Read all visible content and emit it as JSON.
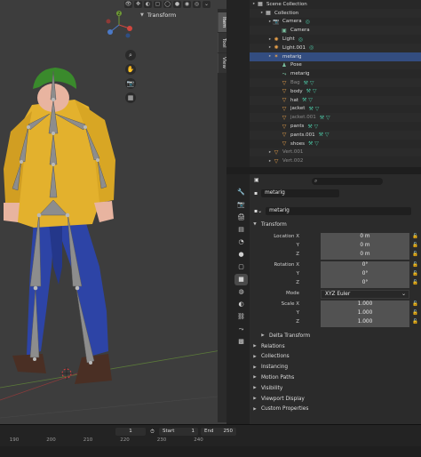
{
  "viewport": {
    "panel_title": "Transform",
    "side_tabs": [
      "Item",
      "Tool",
      "View"
    ],
    "nav_buttons": [
      "zoom-icon",
      "hand-icon",
      "camera-icon",
      "grid-icon"
    ],
    "gizmo_label": "Z"
  },
  "timeline": {
    "current_frame": "1",
    "start_label": "Start",
    "start_value": "1",
    "end_label": "End",
    "end_value": "250",
    "ticks": [
      "190",
      "200",
      "210",
      "220",
      "230",
      "240"
    ]
  },
  "outliner": {
    "rows": [
      {
        "label": "Scene Collection",
        "depth": 0,
        "icon": "collection-icon",
        "dim": false,
        "sel": false
      },
      {
        "label": "Collection",
        "depth": 1,
        "icon": "collection-icon",
        "dim": false,
        "sel": false
      },
      {
        "label": "Camera",
        "depth": 2,
        "icon": "camera-object-icon",
        "dim": false,
        "sel": false
      },
      {
        "label": "Camera",
        "depth": 3,
        "icon": "camera-data-icon",
        "dim": false,
        "sel": false
      },
      {
        "label": "Light",
        "depth": 2,
        "icon": "light-icon",
        "dim": false,
        "sel": false
      },
      {
        "label": "Light.001",
        "depth": 2,
        "icon": "light-icon",
        "dim": false,
        "sel": false
      },
      {
        "label": "metarig",
        "depth": 2,
        "icon": "armature-icon",
        "dim": false,
        "sel": true
      },
      {
        "label": "Pose",
        "depth": 3,
        "icon": "pose-icon",
        "dim": false,
        "sel": false
      },
      {
        "label": "metarig",
        "depth": 3,
        "icon": "armature-data-icon",
        "dim": false,
        "sel": false
      },
      {
        "label": "Bag",
        "depth": 3,
        "icon": "mesh-icon",
        "dim": true,
        "sel": false
      },
      {
        "label": "body",
        "depth": 3,
        "icon": "mesh-icon",
        "dim": false,
        "sel": false
      },
      {
        "label": "hat",
        "depth": 3,
        "icon": "mesh-icon",
        "dim": false,
        "sel": false
      },
      {
        "label": "jacket",
        "depth": 3,
        "icon": "mesh-icon",
        "dim": false,
        "sel": false
      },
      {
        "label": "jacket.001",
        "depth": 3,
        "icon": "mesh-icon",
        "dim": true,
        "sel": false
      },
      {
        "label": "pants",
        "depth": 3,
        "icon": "mesh-icon",
        "dim": false,
        "sel": false
      },
      {
        "label": "pants.001",
        "depth": 3,
        "icon": "mesh-icon",
        "dim": false,
        "sel": false
      },
      {
        "label": "shoes",
        "depth": 3,
        "icon": "mesh-icon",
        "dim": false,
        "sel": false
      },
      {
        "label": "Vert.001",
        "depth": 2,
        "icon": "mesh-icon",
        "dim": true,
        "sel": false
      },
      {
        "label": "Vert.002",
        "depth": 2,
        "icon": "mesh-icon",
        "dim": true,
        "sel": false
      }
    ]
  },
  "properties": {
    "search_placeholder": "",
    "object_name": "metarig",
    "data_name": "metarig",
    "transform_label": "Transform",
    "location_label": "Location X",
    "location": [
      "0 m",
      "0 m",
      "0 m"
    ],
    "rotation_label": "Rotation X",
    "rotation": [
      "0°",
      "0°",
      "0°"
    ],
    "mode_label": "Mode",
    "mode_value": "XYZ Euler",
    "scale_label": "Scale X",
    "scale": [
      "1.000",
      "1.000",
      "1.000"
    ],
    "axis_y": "Y",
    "axis_z": "Z",
    "delta_label": "Delta Transform",
    "sections": [
      "Relations",
      "Collections",
      "Instancing",
      "Motion Paths",
      "Visibility",
      "Viewport Display",
      "Custom Properties"
    ]
  },
  "colors": {
    "accent": "#4772b3",
    "jacket": "#e3b12d",
    "pants": "#2b3f9e",
    "hat": "#3a8a2c",
    "bone": "#8d8d8d"
  }
}
